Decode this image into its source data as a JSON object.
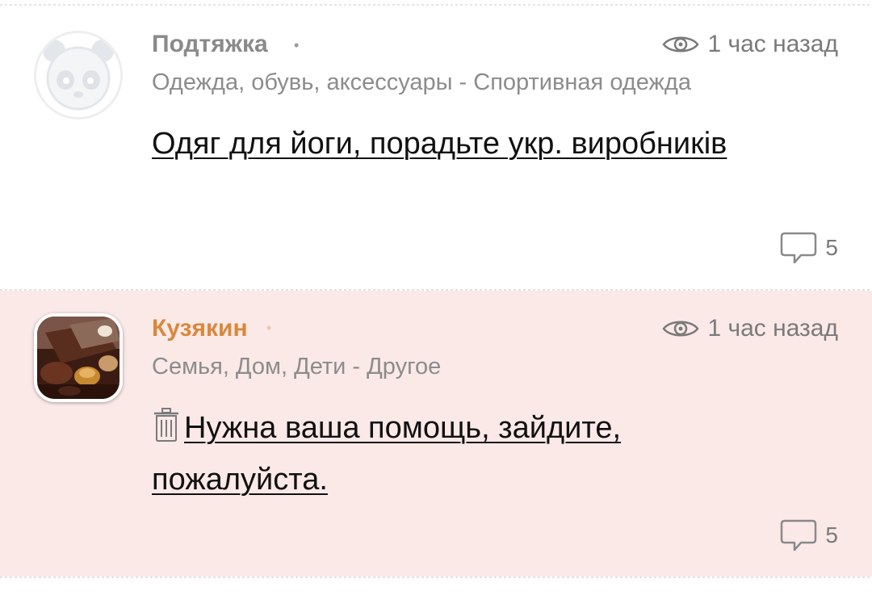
{
  "posts": [
    {
      "author": "Подтяжка",
      "time": "1 час назад",
      "category": "Одежда, обувь, аксессуары - Спортивная одежда",
      "title": "Одяг для йоги, порадьте укр. виробників",
      "comments": "5",
      "avatar_icon": "panda-avatar-icon",
      "author_color": "#8a8a8a"
    },
    {
      "author": "Кузякин",
      "time": "1 час назад",
      "category": "Семья, Дом, Дети - Другое",
      "title": "Нужна ваша помощь, зайдите, пожалуйста.",
      "comments": "5",
      "avatar_icon": "chocolate-photo-avatar",
      "title_icon": "trash-icon",
      "author_color": "#d9883a",
      "highlight_bg": "#fbe9e8"
    }
  ]
}
